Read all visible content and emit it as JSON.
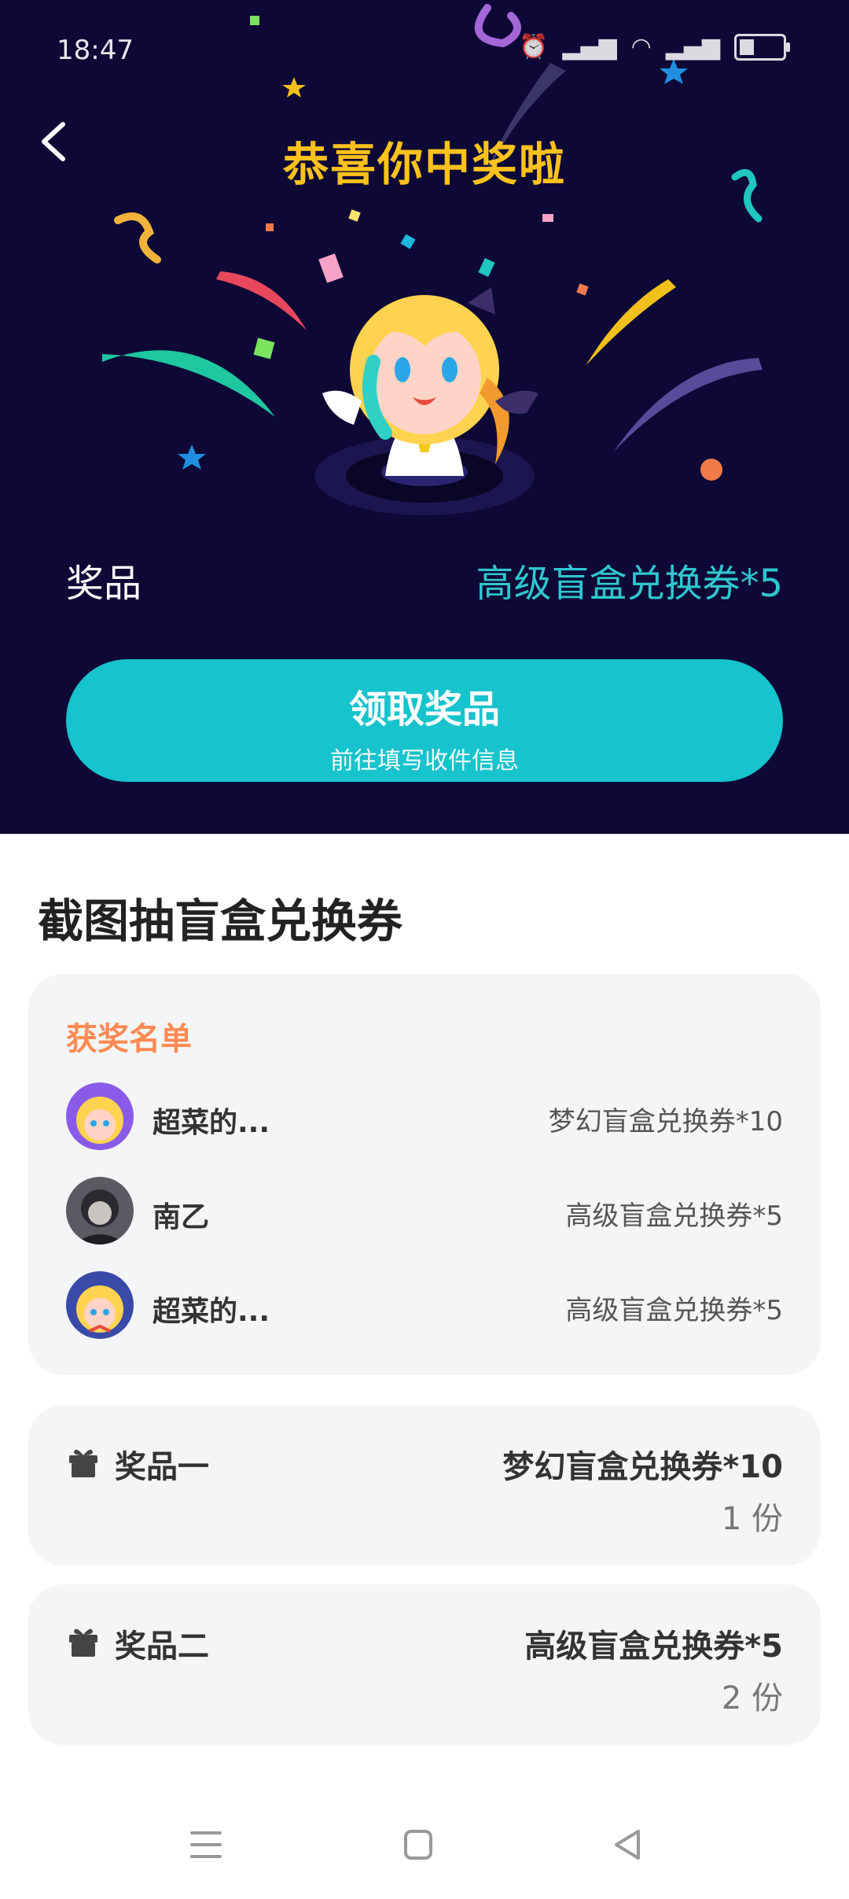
{
  "status_bar": {
    "time": "18:47",
    "battery": "25"
  },
  "header": {
    "title": "恭喜你中奖啦"
  },
  "prize": {
    "label": "奖品",
    "value": "高级盲盒兑换券*5"
  },
  "claim_button": {
    "title": "领取奖品",
    "subtitle": "前往填写收件信息"
  },
  "section": {
    "title": "截图抽盲盒兑换券"
  },
  "winners": {
    "title": "获奖名单",
    "rows": [
      {
        "name": "超菜的...",
        "prize": "梦幻盲盒兑换券*10"
      },
      {
        "name": "南乙",
        "prize": "高级盲盒兑换券*5"
      },
      {
        "name": "超菜的...",
        "prize": "高级盲盒兑换券*5"
      }
    ]
  },
  "prize_list": [
    {
      "label": "奖品一",
      "name": "梦幻盲盒兑换券*10",
      "count": "1 份"
    },
    {
      "label": "奖品二",
      "name": "高级盲盒兑换券*5",
      "count": "2 份"
    }
  ],
  "colors": {
    "hero_bg": "#0d0835",
    "title_gold": "#ffc21c",
    "accent_teal": "#17c3cc",
    "prize_teal": "#2fc7cf",
    "winners_orange": "#ff8a52"
  },
  "icons": {
    "back": "chevron-left-icon",
    "gift": "gift-icon",
    "nav_menu": "menu-icon",
    "nav_home": "home-square-icon",
    "nav_back": "triangle-back-icon"
  }
}
